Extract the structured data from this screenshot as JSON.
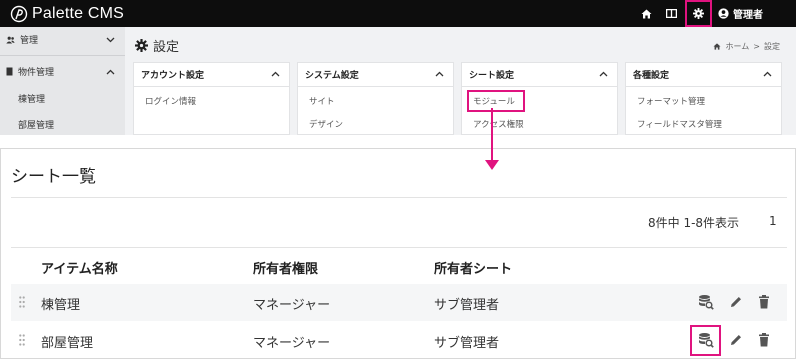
{
  "app": {
    "name": "Palette CMS"
  },
  "header": {
    "user_label": "管理者"
  },
  "sidebar": {
    "items": [
      {
        "label": "管理"
      },
      {
        "label": "物件管理"
      },
      {
        "label": "棟管理"
      },
      {
        "label": "部屋管理"
      }
    ]
  },
  "settings": {
    "title": "設定",
    "breadcrumb": {
      "home": "ホーム",
      "separator": ">",
      "current": "設定"
    },
    "cards": [
      {
        "title": "アカウント設定",
        "links": [
          "ログイン情報"
        ]
      },
      {
        "title": "システム設定",
        "links": [
          "サイト",
          "デザイン"
        ]
      },
      {
        "title": "シート設定",
        "links": [
          "モジュール",
          "アクセス権限"
        ]
      },
      {
        "title": "各種設定",
        "links": [
          "フォーマット管理",
          "フィールドマスタ管理"
        ]
      }
    ]
  },
  "sheet_list": {
    "title": "シート一覧",
    "count_text": "8件中 1-8件表示",
    "page": "1",
    "columns": [
      "アイテム名称",
      "所有者権限",
      "所有者シート"
    ],
    "rows": [
      {
        "name": "棟管理",
        "owner_role": "マネージャー",
        "owner_sheet": "サブ管理者"
      },
      {
        "name": "部屋管理",
        "owner_role": "マネージャー",
        "owner_sheet": "サブ管理者"
      }
    ]
  },
  "colors": {
    "highlight": "#e0137f",
    "topbar": "#0d0d0d",
    "sidebar": "#e6e7e9"
  }
}
